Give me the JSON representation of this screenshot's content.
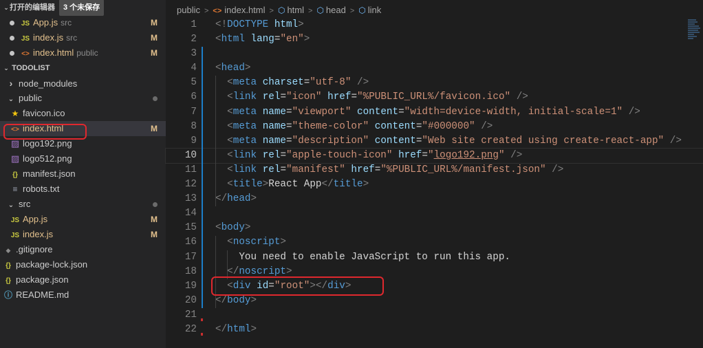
{
  "sidebar": {
    "open_editors": {
      "title": "打开的编辑器",
      "unsaved_badge": "3 个未保存",
      "files": [
        {
          "icon": "JS",
          "name": "App.js",
          "desc": "src",
          "status": "M"
        },
        {
          "icon": "JS",
          "name": "index.js",
          "desc": "src",
          "status": "M"
        },
        {
          "icon": "<>",
          "name": "index.html",
          "desc": "public",
          "status": "M"
        }
      ]
    },
    "project": {
      "title": "TODOLIST",
      "items": [
        {
          "label": "node_modules",
          "icon": "›",
          "status": ""
        },
        {
          "label": "public",
          "icon": "⌄",
          "status": ""
        },
        {
          "label": "favicon.ico",
          "icon": "★",
          "status": ""
        },
        {
          "label": "index.html",
          "icon": "<>",
          "status": "M"
        },
        {
          "label": "logo192.png",
          "icon": "▨",
          "status": ""
        },
        {
          "label": "logo512.png",
          "icon": "▨",
          "status": ""
        },
        {
          "label": "manifest.json",
          "icon": "{}",
          "status": ""
        },
        {
          "label": "robots.txt",
          "icon": "≡",
          "status": ""
        },
        {
          "label": "src",
          "icon": "⌄",
          "status": ""
        },
        {
          "label": "App.js",
          "icon": "JS",
          "status": "M"
        },
        {
          "label": "index.js",
          "icon": "JS",
          "status": "M"
        },
        {
          "label": ".gitignore",
          "icon": "◆",
          "status": ""
        },
        {
          "label": "package-lock.json",
          "icon": "{}",
          "status": ""
        },
        {
          "label": "package.json",
          "icon": "{}",
          "status": ""
        },
        {
          "label": "README.md",
          "icon": "ⓘ",
          "status": ""
        }
      ]
    }
  },
  "breadcrumb": {
    "items": [
      "public",
      "index.html",
      "html",
      "head",
      "link"
    ]
  },
  "code": {
    "active_line": 10,
    "lines": [
      {
        "n": "1",
        "t": [
          [
            "br",
            "<!"
          ],
          [
            "tag",
            "DOCTYPE"
          ],
          [
            "txt",
            " "
          ],
          [
            "attr",
            "html"
          ],
          [
            "br",
            ">"
          ]
        ]
      },
      {
        "n": "2",
        "t": [
          [
            "br",
            "<"
          ],
          [
            "tag",
            "html"
          ],
          [
            "txt",
            " "
          ],
          [
            "attr",
            "lang"
          ],
          [
            "txt",
            "="
          ],
          [
            "str",
            "\"en\""
          ],
          [
            "br",
            ">"
          ]
        ]
      },
      {
        "n": "3",
        "t": []
      },
      {
        "n": "4",
        "t": [
          [
            "br",
            "<"
          ],
          [
            "tag",
            "head"
          ],
          [
            "br",
            ">"
          ]
        ]
      },
      {
        "n": "5",
        "t": [
          [
            "txt",
            "  "
          ],
          [
            "br",
            "<"
          ],
          [
            "tag",
            "meta"
          ],
          [
            "txt",
            " "
          ],
          [
            "attr",
            "charset"
          ],
          [
            "txt",
            "="
          ],
          [
            "str",
            "\"utf-8\""
          ],
          [
            "txt",
            " "
          ],
          [
            "br",
            "/>"
          ]
        ]
      },
      {
        "n": "6",
        "t": [
          [
            "txt",
            "  "
          ],
          [
            "br",
            "<"
          ],
          [
            "tag",
            "link"
          ],
          [
            "txt",
            " "
          ],
          [
            "attr",
            "rel"
          ],
          [
            "txt",
            "="
          ],
          [
            "str",
            "\"icon\""
          ],
          [
            "txt",
            " "
          ],
          [
            "attr",
            "href"
          ],
          [
            "txt",
            "="
          ],
          [
            "str",
            "\"%PUBLIC_URL%/favicon.ico\""
          ],
          [
            "txt",
            " "
          ],
          [
            "br",
            "/>"
          ]
        ]
      },
      {
        "n": "7",
        "t": [
          [
            "txt",
            "  "
          ],
          [
            "br",
            "<"
          ],
          [
            "tag",
            "meta"
          ],
          [
            "txt",
            " "
          ],
          [
            "attr",
            "name"
          ],
          [
            "txt",
            "="
          ],
          [
            "str",
            "\"viewport\""
          ],
          [
            "txt",
            " "
          ],
          [
            "attr",
            "content"
          ],
          [
            "txt",
            "="
          ],
          [
            "str",
            "\"width=device-width, initial-scale=1\""
          ],
          [
            "txt",
            " "
          ],
          [
            "br",
            "/>"
          ]
        ]
      },
      {
        "n": "8",
        "t": [
          [
            "txt",
            "  "
          ],
          [
            "br",
            "<"
          ],
          [
            "tag",
            "meta"
          ],
          [
            "txt",
            " "
          ],
          [
            "attr",
            "name"
          ],
          [
            "txt",
            "="
          ],
          [
            "str",
            "\"theme-color\""
          ],
          [
            "txt",
            " "
          ],
          [
            "attr",
            "content"
          ],
          [
            "txt",
            "="
          ],
          [
            "str",
            "\"#000000\""
          ],
          [
            "txt",
            " "
          ],
          [
            "br",
            "/>"
          ]
        ]
      },
      {
        "n": "9",
        "t": [
          [
            "txt",
            "  "
          ],
          [
            "br",
            "<"
          ],
          [
            "tag",
            "meta"
          ],
          [
            "txt",
            " "
          ],
          [
            "attr",
            "name"
          ],
          [
            "txt",
            "="
          ],
          [
            "str",
            "\"description\""
          ],
          [
            "txt",
            " "
          ],
          [
            "attr",
            "content"
          ],
          [
            "txt",
            "="
          ],
          [
            "str",
            "\"Web site created using create-react-app\""
          ],
          [
            "txt",
            " "
          ],
          [
            "br",
            "/>"
          ]
        ]
      },
      {
        "n": "10",
        "t": [
          [
            "txt",
            "  "
          ],
          [
            "br",
            "<"
          ],
          [
            "tag",
            "link"
          ],
          [
            "txt",
            " "
          ],
          [
            "attr",
            "rel"
          ],
          [
            "txt",
            "="
          ],
          [
            "str",
            "\"apple-touch-icon\""
          ],
          [
            "txt",
            " "
          ],
          [
            "attr",
            "href"
          ],
          [
            "txt",
            "="
          ],
          [
            "str",
            "\""
          ],
          [
            "stru",
            "logo192.png"
          ],
          [
            "str",
            "\""
          ],
          [
            "txt",
            " "
          ],
          [
            "br",
            "/>"
          ]
        ]
      },
      {
        "n": "11",
        "t": [
          [
            "txt",
            "  "
          ],
          [
            "br",
            "<"
          ],
          [
            "tag",
            "link"
          ],
          [
            "txt",
            " "
          ],
          [
            "attr",
            "rel"
          ],
          [
            "txt",
            "="
          ],
          [
            "str",
            "\"manifest\""
          ],
          [
            "txt",
            " "
          ],
          [
            "attr",
            "href"
          ],
          [
            "txt",
            "="
          ],
          [
            "str",
            "\"%PUBLIC_URL%/manifest.json\""
          ],
          [
            "txt",
            " "
          ],
          [
            "br",
            "/>"
          ]
        ]
      },
      {
        "n": "12",
        "t": [
          [
            "txt",
            "  "
          ],
          [
            "br",
            "<"
          ],
          [
            "tag",
            "title"
          ],
          [
            "br",
            ">"
          ],
          [
            "txt",
            "React App"
          ],
          [
            "br",
            "</"
          ],
          [
            "tag",
            "title"
          ],
          [
            "br",
            ">"
          ]
        ]
      },
      {
        "n": "13",
        "t": [
          [
            "br",
            "</"
          ],
          [
            "tag",
            "head"
          ],
          [
            "br",
            ">"
          ]
        ]
      },
      {
        "n": "14",
        "t": []
      },
      {
        "n": "15",
        "t": [
          [
            "br",
            "<"
          ],
          [
            "tag",
            "body"
          ],
          [
            "br",
            ">"
          ]
        ]
      },
      {
        "n": "16",
        "t": [
          [
            "txt",
            "  "
          ],
          [
            "br",
            "<"
          ],
          [
            "tag",
            "noscript"
          ],
          [
            "br",
            ">"
          ]
        ]
      },
      {
        "n": "17",
        "t": [
          [
            "txt",
            "    You need to enable JavaScript to run this app."
          ]
        ]
      },
      {
        "n": "18",
        "t": [
          [
            "txt",
            "  "
          ],
          [
            "br",
            "</"
          ],
          [
            "tag",
            "noscript"
          ],
          [
            "br",
            ">"
          ]
        ]
      },
      {
        "n": "19",
        "t": [
          [
            "txt",
            "  "
          ],
          [
            "br",
            "<"
          ],
          [
            "tag",
            "div"
          ],
          [
            "txt",
            " "
          ],
          [
            "attr",
            "id"
          ],
          [
            "txt",
            "="
          ],
          [
            "str",
            "\"root\""
          ],
          [
            "br",
            "></"
          ],
          [
            "tag",
            "div"
          ],
          [
            "br",
            ">"
          ]
        ]
      },
      {
        "n": "20",
        "t": [
          [
            "br",
            "</"
          ],
          [
            "tag",
            "body"
          ],
          [
            "br",
            ">"
          ]
        ]
      },
      {
        "n": "21",
        "t": []
      },
      {
        "n": "22",
        "t": [
          [
            "br",
            "</"
          ],
          [
            "tag",
            "html"
          ],
          [
            "br",
            ">"
          ]
        ]
      }
    ]
  }
}
